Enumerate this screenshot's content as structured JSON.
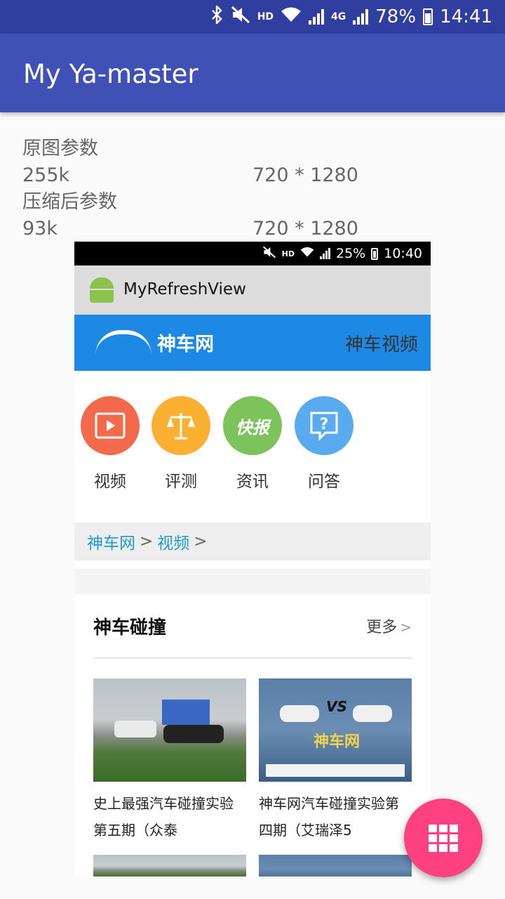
{
  "status_bar": {
    "network_hd": "HD",
    "network_4g": "4G",
    "battery": "78%",
    "time": "14:41"
  },
  "app_bar": {
    "title": "My Ya-master"
  },
  "info": {
    "original_label": "原图参数",
    "original_size": "255k",
    "original_dims": "720 * 1280",
    "compressed_label": "压缩后参数",
    "compressed_size": "93k",
    "compressed_dims": "720 * 1280"
  },
  "embedded": {
    "status_bar": {
      "hd": "HD",
      "battery": "25%",
      "time": "10:40"
    },
    "app_title": "MyRefreshView",
    "banner": {
      "logo_text": "神车网",
      "right_text": "神车视频"
    },
    "categories": [
      {
        "label": "视频",
        "icon": "play-icon",
        "color": "#F26A4B"
      },
      {
        "label": "评测",
        "icon": "scale-icon",
        "color": "#FBB032"
      },
      {
        "label": "资讯",
        "icon": "news-icon",
        "color": "#7DC35B",
        "icon_text": "快报"
      },
      {
        "label": "问答",
        "icon": "question-icon",
        "color": "#5AAAF0"
      }
    ],
    "breadcrumb": {
      "home": "神车网",
      "sep": ">",
      "current": "视频",
      "sep2": ">"
    },
    "section": {
      "title": "神车碰撞",
      "more": "更多",
      "more_chevron": ">",
      "cards": [
        {
          "caption_line1": "史上最强汽车碰撞实验",
          "caption_line2": "第五期（众泰"
        },
        {
          "caption_line1": "神车网汽车碰撞实验第",
          "caption_line2": "四期（艾瑞泽5",
          "thumb_text": "神车网",
          "thumb_vs": "VS"
        }
      ]
    }
  },
  "colors": {
    "primary": "#3F51B5",
    "primary_dark": "#303F9F",
    "accent": "#FF4081",
    "banner": "#1E88E5"
  },
  "fab": {
    "icon": "apps-grid-icon"
  }
}
